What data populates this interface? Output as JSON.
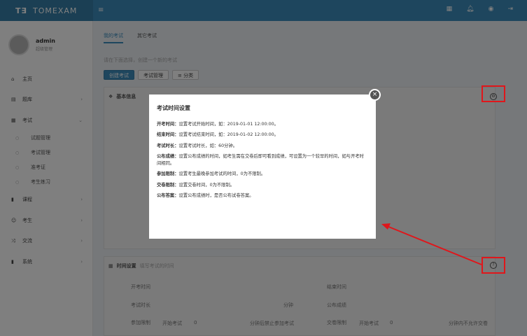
{
  "app": {
    "logo_mark": "T∃",
    "name": "TOMEXAM",
    "menu_icon": "hamburger-icon"
  },
  "topbar": {
    "icons": [
      "menu-grid-icon",
      "bell-icon",
      "user-circle-icon",
      "logout-icon"
    ]
  },
  "user": {
    "name": "admin",
    "role": "超级管理"
  },
  "sidebar": {
    "items": [
      {
        "label": "主页",
        "icon": "home-icon"
      },
      {
        "label": "题库",
        "icon": "database-icon"
      },
      {
        "label": "考试",
        "icon": "calendar-icon"
      },
      {
        "label": "课程",
        "icon": "book-icon"
      },
      {
        "label": "考生",
        "icon": "user-icon"
      },
      {
        "label": "交流",
        "icon": "shuffle-icon"
      },
      {
        "label": "系统",
        "icon": "database-icon"
      }
    ],
    "exam_sub": [
      "试题管理",
      "考试管理",
      "准考证",
      "考生练习"
    ]
  },
  "tabs": [
    "我的考试",
    "其它考试"
  ],
  "hint": "请在下面选择，创建一个新的考试",
  "buttons": {
    "create": "创建考试",
    "manage": "考试管理",
    "sort": "≡ 分类"
  },
  "basic_panel": {
    "title": "基本信息"
  },
  "time_panel": {
    "title": "时间设置",
    "subtitle": "填写考试的时间"
  },
  "background_fields": {
    "start": "开考时间",
    "end": "结束时间",
    "duration": "考试时长",
    "publish": "公布成绩",
    "join_limit": "参加限制",
    "submit_limit": "交卷限制",
    "minutes": "分钟",
    "start_exam": "开始考试",
    "zero": "0",
    "after_minutes": "分钟后禁止参加考试",
    "no_submit": "分钟内不允许交卷"
  },
  "modal": {
    "title": "考试时间设置",
    "lines": [
      {
        "k": "开考时间：",
        "v": "设置考试开始时间，如：2019-01-01 12:00:00。"
      },
      {
        "k": "结束时间：",
        "v": "设置考试结束时间，如：2019-01-02 12:00:00。"
      },
      {
        "k": "考试时长：",
        "v": "设置考试时长，如：60分钟。"
      },
      {
        "k": "公布成绩：",
        "v": "设置公布成绩的时间，如考生需在交卷后即可看到成绩，可设置为一个较早的时间，如与开考时间相同。"
      },
      {
        "k": "参加限制：",
        "v": "设置考生最晚参加考试的时间，0为不限制。"
      },
      {
        "k": "交卷限制：",
        "v": "设置交卷时间，0为不限制。"
      },
      {
        "k": "公布答案：",
        "v": "设置公布成绩时，是否公布试卷答案。"
      }
    ]
  },
  "colors": {
    "brand": "#3c8dbc",
    "brand_dark": "#367fa9",
    "annotation": "#e0161b"
  }
}
